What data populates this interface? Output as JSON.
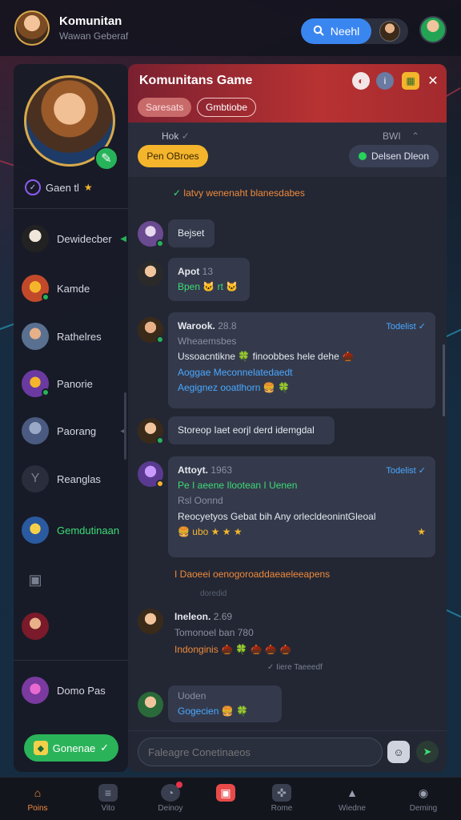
{
  "app": {
    "title": "Komunitan",
    "subtitle": "Wawan Geberaf"
  },
  "topbar": {
    "search_label": "Neehl"
  },
  "profile": {
    "status": "Gaen tl"
  },
  "sidebar": {
    "items": [
      {
        "label": "Dewidecber",
        "color": "#3b2a1a",
        "active": false
      },
      {
        "label": "Kamde",
        "color": "#c24a2a",
        "active": false
      },
      {
        "label": "Rathelres",
        "color": "#5a7090",
        "active": false
      },
      {
        "label": "Panorie",
        "color": "#6a3aa0",
        "active": false
      },
      {
        "label": "Paorang",
        "color": "#4a5a80",
        "active": false
      },
      {
        "label": "Reanglas",
        "color": "#3a3f50",
        "active": false
      },
      {
        "label": "Gemdutinaan",
        "color": "#2a5aa0",
        "active": true
      },
      {
        "label": "",
        "color": "#3a3f50",
        "active": false
      },
      {
        "label": "",
        "color": "#7a1a2a",
        "active": false
      },
      {
        "label": "Domo Pas",
        "color": "#7a3aa0",
        "active": false
      }
    ],
    "cta_label": "Gonenae"
  },
  "chat": {
    "title": "Komunitans Game",
    "chip_a": "Saresats",
    "chip_b": "Gmbtiobe",
    "sub_left": "Hok",
    "sub_right": "BWI",
    "pill_yellow": "Pen OBroes",
    "pill_dark": "Delsen Dleon",
    "system_line": "latvy wenenaht blanesdabes",
    "messages": [
      {
        "name": "Bejset",
        "time": "",
        "lines": []
      },
      {
        "name": "Apot",
        "time": "13",
        "lines": [
          "Bpen 🐱 rt 🐱"
        ]
      },
      {
        "name": "Warook.",
        "time": "28.8",
        "tag": "Todelist",
        "lines": [
          "Wheaemsbes",
          "Ussoacntikne 🍀 finoobbes hele dehe 🌰",
          "Aoggae Meconnelatedaedt",
          "Aegignez ooatlhorn 🍔 🍀"
        ]
      },
      {
        "name": "Storeop Iaet eorjl derd idemgdal",
        "time": "",
        "lines": []
      },
      {
        "name": "Attoyt.",
        "time": "1963",
        "tag": "Todelist",
        "lines": [
          "Pe I aeene Ilootean I Uenen",
          "Rsl Oonnd",
          "Reocyetyos Gebat bih Any orlecldeonintGleoal",
          "🍔 ubo ★ ★ ★"
        ]
      },
      {
        "name": "I Daoeei oenogoroaddaeaeleeapens",
        "time": "",
        "lines": []
      },
      {
        "name": "Ineleon.",
        "time": "2.69",
        "lines": [
          "Tomonoel ban 780",
          "Indonginis 🌰 🍀 🌰 🌰 🌰"
        ]
      },
      {
        "name": "Uoden",
        "time": "",
        "lines": [
          "Gogecien 🍔 🍀"
        ]
      }
    ],
    "ts_between": "doredid",
    "ts_note": "Iiere Taeeedf",
    "composer_placeholder": "Faleagre Conetinaeos"
  },
  "bottomnav": {
    "items": [
      {
        "label": "Poins",
        "icon": "home-icon",
        "active": true
      },
      {
        "label": "Vito",
        "icon": "list-icon",
        "active": false
      },
      {
        "label": "Deinoy",
        "icon": "gauge-icon",
        "active": false
      },
      {
        "label": "",
        "icon": "gift-icon",
        "active": false
      },
      {
        "label": "Rome",
        "icon": "gamepad-icon",
        "active": false
      },
      {
        "label": "Wiedne",
        "icon": "mountain-icon",
        "active": false
      },
      {
        "label": "Deming",
        "icon": "target-icon",
        "active": false
      }
    ]
  },
  "colors": {
    "accent": "#3a86f0",
    "header": "#b83232",
    "online": "#27b35a"
  }
}
